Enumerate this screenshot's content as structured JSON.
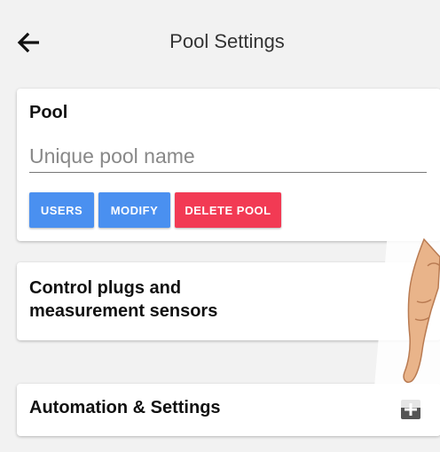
{
  "header": {
    "title": "Pool Settings",
    "back_icon": "arrow-left-icon"
  },
  "pool_card": {
    "title": "Pool",
    "name_placeholder": "Unique pool name",
    "name_value": "",
    "buttons": {
      "users": "USERS",
      "modify": "MODIFY",
      "delete": "DELETE POOL"
    }
  },
  "plugs_card": {
    "title": "Control plugs and measurement sensors"
  },
  "automation_card": {
    "title": "Automation & Settings",
    "expand_icon": "plus-box-icon"
  },
  "colors": {
    "primary": "#4a90f0",
    "danger": "#f23a54",
    "background": "#f2f2f2",
    "card": "#ffffff"
  }
}
